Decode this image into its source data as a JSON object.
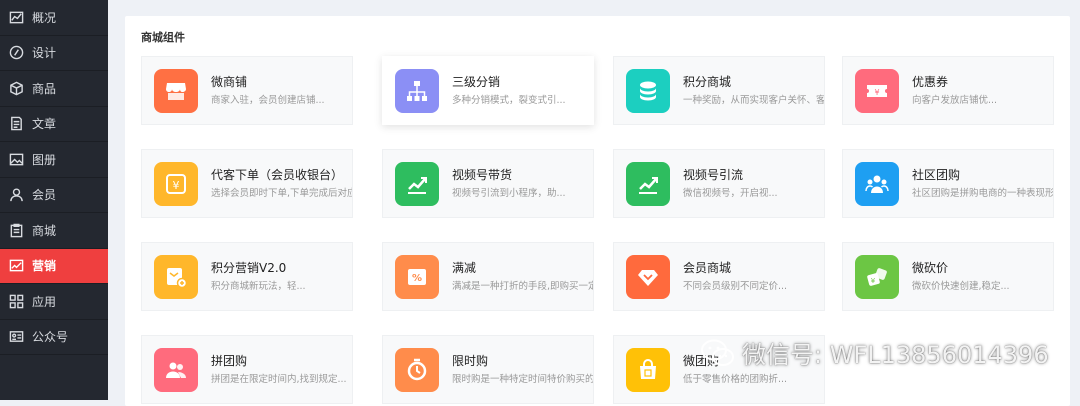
{
  "sidebar": {
    "items": [
      {
        "label": "概况",
        "icon": "chart-line-icon",
        "active": false
      },
      {
        "label": "设计",
        "icon": "palette-icon",
        "active": false
      },
      {
        "label": "商品",
        "icon": "box-icon",
        "active": false
      },
      {
        "label": "文章",
        "icon": "document-icon",
        "active": false
      },
      {
        "label": "图册",
        "icon": "image-icon",
        "active": false
      },
      {
        "label": "会员",
        "icon": "user-icon",
        "active": false
      },
      {
        "label": "商城",
        "icon": "clipboard-icon",
        "active": false
      },
      {
        "label": "营销",
        "icon": "trend-chart-icon",
        "active": true
      },
      {
        "label": "应用",
        "icon": "grid-icon",
        "active": false
      },
      {
        "label": "公众号",
        "icon": "id-card-icon",
        "active": false
      }
    ]
  },
  "section_title": "商城组件",
  "cards": [
    {
      "title": "微商铺",
      "desc": "商家入驻，会员创建店铺...",
      "icon": "shop-icon",
      "color": "#ff7043"
    },
    {
      "title": "三级分销",
      "desc": "多种分销模式，裂变式引...",
      "icon": "hierarchy-icon",
      "color": "#8b8ff5"
    },
    {
      "title": "积分商城",
      "desc": "一种奖励，从而实现客户关怀、客",
      "icon": "coins-icon",
      "color": "#1ccfc0"
    },
    {
      "title": "优惠券",
      "desc": "向客户发放店铺优...",
      "icon": "coupon-icon",
      "color": "#ff6b7d"
    },
    {
      "title": "代客下单（会员收银台）",
      "desc": "选择会员即时下单,下单完成后对应会",
      "icon": "cashier-icon",
      "color": "#ffb72b"
    },
    {
      "title": "视频号带货",
      "desc": "视频号引流到小程序，助...",
      "icon": "growth-chart-icon",
      "color": "#2ebd5f"
    },
    {
      "title": "视频号引流",
      "desc": "微信视频号，开启视...",
      "icon": "growth-chart-icon",
      "color": "#2ebd5f"
    },
    {
      "title": "社区团购",
      "desc": "社区团购是拼购电商的一种表现形",
      "icon": "community-icon",
      "color": "#1e9ff2"
    },
    {
      "title": "积分营销V2.0",
      "desc": "积分商城新玩法，轻...",
      "icon": "points-icon",
      "color": "#ffb72b"
    },
    {
      "title": "满减",
      "desc": "满减是一种打折的手段,即购买一定",
      "icon": "discount-icon",
      "color": "#ff8c4b"
    },
    {
      "title": "会员商城",
      "desc": "不同会员级别不同定价...",
      "icon": "diamond-icon",
      "color": "#ff6a3d"
    },
    {
      "title": "微砍价",
      "desc": "微砍价快速创建,稳定...",
      "icon": "bargain-icon",
      "color": "#6cc644"
    },
    {
      "title": "拼团购",
      "desc": "拼团是在限定时间内,找到规定...",
      "icon": "group-icon",
      "color": "#ff6b7d"
    },
    {
      "title": "限时购",
      "desc": "限时购是一种特定时间特价购买的",
      "icon": "timer-icon",
      "color": "#ff8c4b"
    },
    {
      "title": "微团购",
      "desc": "低于零售价格的团购折...",
      "icon": "bag-icon",
      "color": "#ffc107"
    }
  ],
  "watermark": "微信号: WFL13856014396"
}
